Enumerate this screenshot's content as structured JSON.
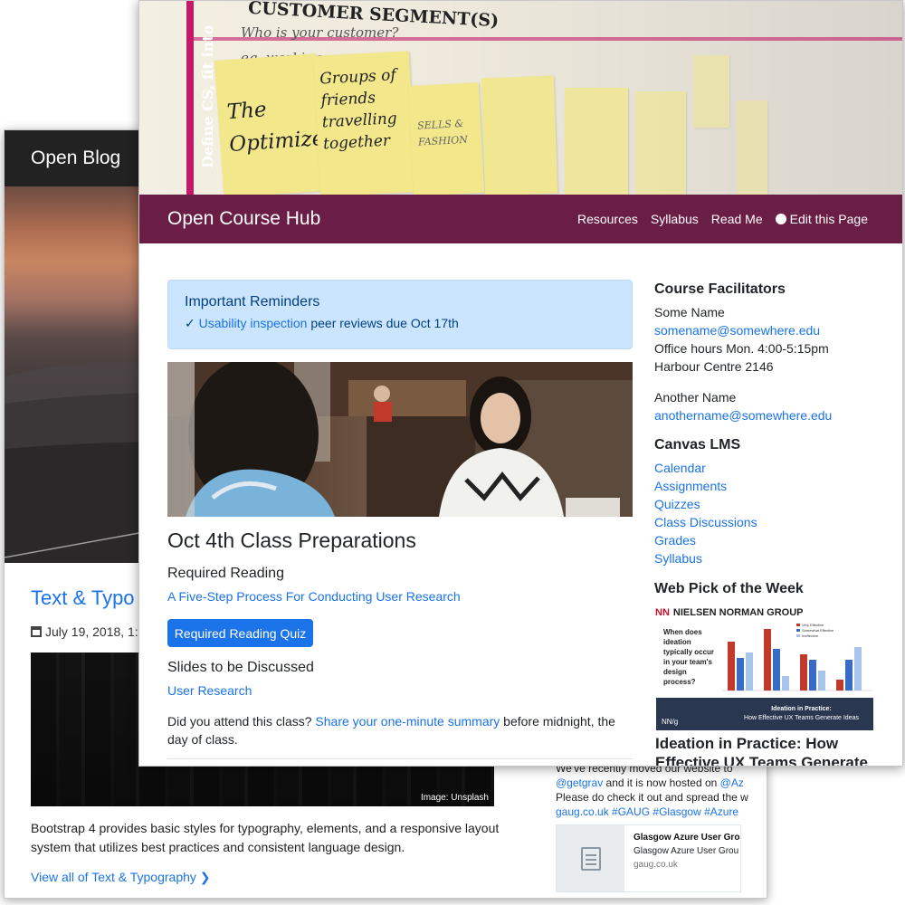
{
  "back_window": {
    "brand": "Open Blog",
    "post_title": "Text & Typo",
    "post_date": "July 19, 2018, 1:3",
    "image_caption": "Image: Unsplash",
    "body": "Bootstrap 4 provides basic styles for typography, elements, and a responsive layout system that utilizes best practices and consistent language design.",
    "view_all": "View all of Text & Typography",
    "tweet": {
      "line1": "We've recently moved our website to",
      "mention": "@getgrav",
      "line2_mid": " and it is now hosted on ",
      "mention2": "@Az",
      "line3": "Please do check it out and spread the w",
      "line4_tags": "gaug.co.uk #GAUG #Glasgow #Azure"
    },
    "card": {
      "title": "Glasgow Azure User Gro",
      "subtitle": "Glasgow Azure User Grou",
      "domain": "gaug.co.uk"
    }
  },
  "front_window": {
    "hero_notes": {
      "header": "CUSTOMER SEGMENT(S)",
      "sub1": "Who is your customer?",
      "sub2": "eg. working par",
      "side_text": "Define CS, fit into",
      "note1": "The Optimizer",
      "note2": "Groups of friends travelling together",
      "note3": "SELLS & FASHION"
    },
    "brand": "Open Course Hub",
    "nav": {
      "resources": "Resources",
      "syllabus": "Syllabus",
      "read_me": "Read Me",
      "edit": "Edit this Page"
    },
    "alert": {
      "title": "Important Reminders",
      "check": "✓",
      "link": "Usability inspection",
      "rest": " peer reviews due Oct 17th"
    },
    "class_title": "Oct 4th Class Preparations",
    "required_reading": {
      "heading": "Required Reading",
      "link": "A Five-Step Process For Conducting User Research"
    },
    "quiz_button": "Required Reading Quiz",
    "slides": {
      "heading": "Slides to be Discussed",
      "link": "User Research"
    },
    "attend": {
      "before": "Did you attend this class? ",
      "link": "Share your one-minute summary",
      "after": " before midnight, the day of class."
    },
    "sidebar": {
      "facilitators_heading": "Course Facilitators",
      "f1_name": "Some Name",
      "f1_email": "somename@somewhere.edu",
      "f1_hours": "Office hours Mon. 4:00-5:15pm",
      "f1_room": "Harbour Centre 2146",
      "f2_name": "Another Name",
      "f2_email": "anothername@somewhere.edu",
      "canvas_heading": "Canvas LMS",
      "canvas_links": [
        "Calendar",
        "Assignments",
        "Quizzes",
        "Class Discussions",
        "Grades",
        "Syllabus"
      ],
      "pick_heading": "Web Pick of the Week",
      "nng": {
        "logo": "NN",
        "org": "NIELSEN NORMAN GROUP",
        "question": "When does ideation typically occur in your team's design process?",
        "legend": [
          "Very Effective",
          "Somewhat Effective",
          "Ineffective"
        ],
        "banner_l1": "Ideation in Practice:",
        "banner_l2": "How Effective UX Teams Generate Ideas",
        "small_logo": "NN/g",
        "site": "nngroup.com"
      },
      "pick_title": "Ideation in Practice: How Effective UX Teams Generate"
    }
  },
  "colors": {
    "navbar": "#6b1e45",
    "link": "#1a73e8",
    "alert_bg": "#cce5ff",
    "button": "#1a73e8",
    "blog_nav": "#222222"
  }
}
